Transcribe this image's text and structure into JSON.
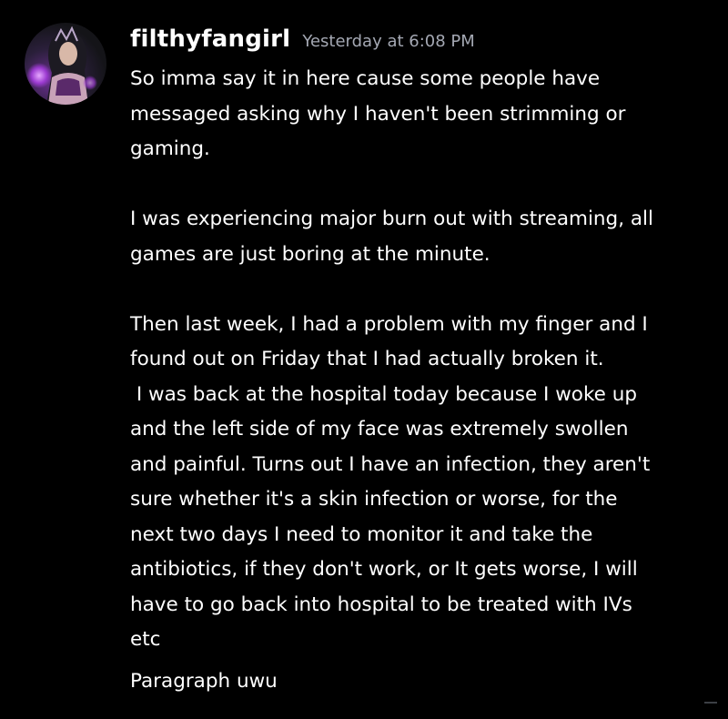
{
  "colors": {
    "background": "#000000",
    "text": "#ffffff",
    "timestamp": "#a4a8b3"
  },
  "message": {
    "author": "filthyfangirl",
    "timestamp": "Yesterday at 6:08 PM",
    "avatar_icon": "user-avatar-icon",
    "lines": [
      "So imma say it in here cause some people have",
      "messaged asking why I haven't been strimming or",
      "gaming.",
      "",
      "I was experiencing major burn out with streaming, all",
      "games are just boring at the minute.",
      "",
      "Then last week, I had a problem with my finger and I",
      "found out on Friday that I had actually broken it.",
      " I was back at the hospital today because I woke up",
      "and the left side of my face was extremely swollen",
      "and painful. Turns out I have an infection, they aren't",
      "sure whether it's a skin infection or worse, for the",
      "next two days I need to monitor it and take the",
      "antibiotics, if they don't work, or It gets worse, I will",
      "have to go back into hospital to be treated with IVs",
      "etc"
    ]
  },
  "followup": {
    "text": "Paragraph uwu"
  }
}
